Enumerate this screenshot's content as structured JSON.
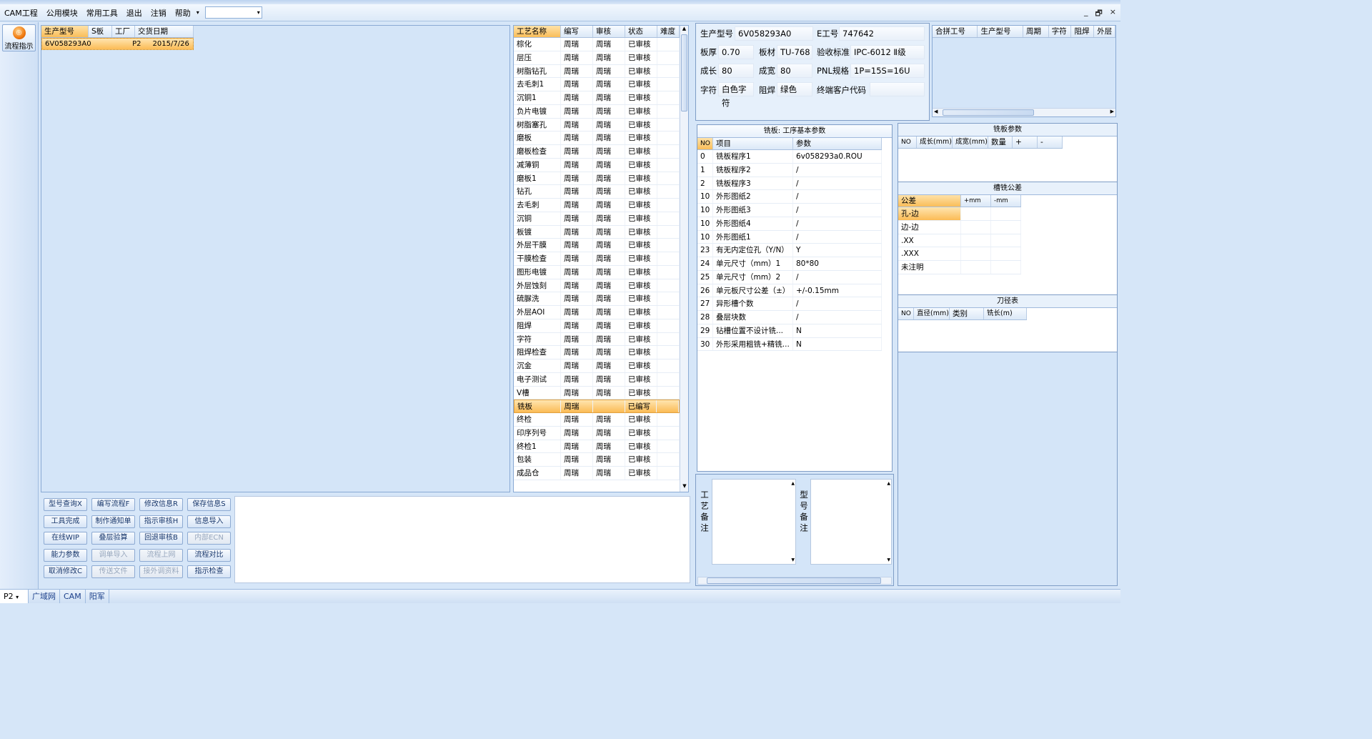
{
  "menu": {
    "items": [
      "CAM工程",
      "公用模块",
      "常用工具",
      "退出",
      "注销",
      "帮助"
    ],
    "combo_value": ""
  },
  "window_controls": {
    "minimize": "_",
    "restore": "🗗",
    "close": "×"
  },
  "sidebar": {
    "flow_label": "流程指示"
  },
  "orders": {
    "columns": [
      "生产型号",
      "S板",
      "工厂",
      "交货日期"
    ],
    "rows": [
      [
        "6V058293A0",
        "",
        "P2",
        "2015/7/26"
      ]
    ]
  },
  "process": {
    "columns": [
      "工艺名称",
      "编写",
      "审核",
      "状态",
      "难度"
    ],
    "rows": [
      [
        "棕化",
        "周瑞",
        "周瑞",
        "已审核",
        ""
      ],
      [
        "层压",
        "周瑞",
        "周瑞",
        "已审核",
        ""
      ],
      [
        "树脂钻孔",
        "周瑞",
        "周瑞",
        "已审核",
        ""
      ],
      [
        "去毛刺1",
        "周瑞",
        "周瑞",
        "已审核",
        ""
      ],
      [
        "沉铜1",
        "周瑞",
        "周瑞",
        "已审核",
        ""
      ],
      [
        "负片电镀",
        "周瑞",
        "周瑞",
        "已审核",
        ""
      ],
      [
        "树脂塞孔",
        "周瑞",
        "周瑞",
        "已审核",
        ""
      ],
      [
        "磨板",
        "周瑞",
        "周瑞",
        "已审核",
        ""
      ],
      [
        "磨板检查",
        "周瑞",
        "周瑞",
        "已审核",
        ""
      ],
      [
        "减薄铜",
        "周瑞",
        "周瑞",
        "已审核",
        ""
      ],
      [
        "磨板1",
        "周瑞",
        "周瑞",
        "已审核",
        ""
      ],
      [
        "钻孔",
        "周瑞",
        "周瑞",
        "已审核",
        ""
      ],
      [
        "去毛刺",
        "周瑞",
        "周瑞",
        "已审核",
        ""
      ],
      [
        "沉铜",
        "周瑞",
        "周瑞",
        "已审核",
        ""
      ],
      [
        "板镀",
        "周瑞",
        "周瑞",
        "已审核",
        ""
      ],
      [
        "外层干膜",
        "周瑞",
        "周瑞",
        "已审核",
        ""
      ],
      [
        "干膜检查",
        "周瑞",
        "周瑞",
        "已审核",
        ""
      ],
      [
        "图形电镀",
        "周瑞",
        "周瑞",
        "已审核",
        ""
      ],
      [
        "外层蚀刻",
        "周瑞",
        "周瑞",
        "已审核",
        ""
      ],
      [
        "硫脲洗",
        "周瑞",
        "周瑞",
        "已审核",
        ""
      ],
      [
        "外层AOI",
        "周瑞",
        "周瑞",
        "已审核",
        ""
      ],
      [
        "阻焊",
        "周瑞",
        "周瑞",
        "已审核",
        ""
      ],
      [
        "字符",
        "周瑞",
        "周瑞",
        "已审核",
        ""
      ],
      [
        "阻焊检查",
        "周瑞",
        "周瑞",
        "已审核",
        ""
      ],
      [
        "沉金",
        "周瑞",
        "周瑞",
        "已审核",
        ""
      ],
      [
        "电子测试",
        "周瑞",
        "周瑞",
        "已审核",
        ""
      ],
      [
        "V槽",
        "周瑞",
        "周瑞",
        "已审核",
        ""
      ],
      [
        "铣板",
        "周瑞",
        "",
        "已编写",
        ""
      ],
      [
        "终检",
        "周瑞",
        "周瑞",
        "已审核",
        ""
      ],
      [
        "印序列号",
        "周瑞",
        "周瑞",
        "已审核",
        ""
      ],
      [
        "终检1",
        "周瑞",
        "周瑞",
        "已审核",
        ""
      ],
      [
        "包装",
        "周瑞",
        "周瑞",
        "已审核",
        ""
      ],
      [
        "成品仓",
        "周瑞",
        "周瑞",
        "已审核",
        ""
      ]
    ]
  },
  "buttons": [
    {
      "label": "型号查询X",
      "enabled": true
    },
    {
      "label": "编写流程F",
      "enabled": true
    },
    {
      "label": "修改信息R",
      "enabled": true
    },
    {
      "label": "保存信息S",
      "enabled": true
    },
    {
      "label": "工具完成",
      "enabled": true
    },
    {
      "label": "制作通知单",
      "enabled": true
    },
    {
      "label": "指示审核H",
      "enabled": true
    },
    {
      "label": "信息导入",
      "enabled": true
    },
    {
      "label": "在线WIP",
      "enabled": true
    },
    {
      "label": "叠层验算",
      "enabled": true
    },
    {
      "label": "回退审核B",
      "enabled": true
    },
    {
      "label": "内部ECN",
      "enabled": false
    },
    {
      "label": "能力参数",
      "enabled": true
    },
    {
      "label": "调单导入",
      "enabled": false
    },
    {
      "label": "流程上网",
      "enabled": false
    },
    {
      "label": "流程对比",
      "enabled": true
    },
    {
      "label": "取消修改C",
      "enabled": true
    },
    {
      "label": "传送文件",
      "enabled": false
    },
    {
      "label": "接外调资料",
      "enabled": false
    },
    {
      "label": "指示检查",
      "enabled": true
    }
  ],
  "info": {
    "model_label": "生产型号",
    "model": "6V058293A0",
    "e_label": "E工号",
    "e_value": "747642",
    "thick_label": "板厚",
    "thick": "0.70",
    "material_label": "板材",
    "material": "TU-768",
    "std_label": "验收标准",
    "std": "IPC-6012 Ⅱ级",
    "len_label": "成长",
    "len": "80",
    "wid_label": "成宽",
    "wid": "80",
    "pnl_label": "PNL规格",
    "pnl": "1P=15S=16U",
    "char_label": "字符",
    "char": "白色字符",
    "mask_label": "阻焊",
    "mask": "绿色",
    "customer_label": "终端客户代码",
    "customer": ""
  },
  "merge": {
    "columns": [
      "合拼工号",
      "生产型号",
      "周期",
      "字符",
      "阻焊",
      "外层"
    ]
  },
  "milling": {
    "title": "铣板: 工序基本参数",
    "columns": [
      "NO",
      "项目",
      "参数"
    ],
    "rows": [
      [
        "0",
        "铣板程序1",
        "6v058293a0.ROU"
      ],
      [
        "1",
        "铣板程序2",
        "/"
      ],
      [
        "2",
        "铣板程序3",
        "/"
      ],
      [
        "10",
        "外形图纸2",
        "/"
      ],
      [
        "10",
        "外形图纸3",
        "/"
      ],
      [
        "10",
        "外形图纸4",
        "/"
      ],
      [
        "10",
        "外形图纸1",
        "/"
      ],
      [
        "23",
        "有无内定位孔（Y/N）",
        "Y"
      ],
      [
        "24",
        "单元尺寸（mm）1",
        "80*80"
      ],
      [
        "25",
        "单元尺寸（mm）2",
        "/"
      ],
      [
        "26",
        "单元板尺寸公差（±）",
        "+/-0.15mm"
      ],
      [
        "27",
        "异形槽个数",
        "/"
      ],
      [
        "28",
        "叠层块数",
        "/"
      ],
      [
        "29",
        "钻槽位置不设计铣...",
        "N"
      ],
      [
        "30",
        "外形采用粗铣+精铣...",
        "N"
      ]
    ]
  },
  "mill_params": {
    "title": "铣板参数",
    "columns": [
      "NO",
      "成长(mm)",
      "成宽(mm)",
      "数量",
      "+",
      "-"
    ]
  },
  "tolerance": {
    "title": "槽铣公差",
    "columns": [
      "公差",
      "+mm",
      "-mm"
    ],
    "rows": [
      "孔-边",
      "边-边",
      ".XX",
      ".XXX",
      "未注明"
    ]
  },
  "tools": {
    "title": "刀径表",
    "columns": [
      "NO",
      "直径(mm)",
      "类别",
      "铣长(m)"
    ]
  },
  "remarks": {
    "process_label": "工艺备注",
    "model_label": "型号备注"
  },
  "status": {
    "factory": "P2",
    "network": "广域网",
    "dept": "CAM",
    "user": "阳军"
  }
}
